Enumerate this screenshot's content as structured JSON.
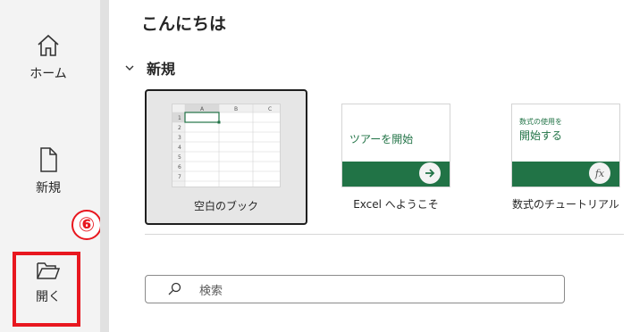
{
  "sidebar": {
    "home_label": "ホーム",
    "new_label": "新規",
    "open_label": "開く",
    "step_badge": "⑥"
  },
  "main": {
    "greeting": "こんにちは",
    "new_section_title": "新規",
    "templates": [
      {
        "label": "空白のブック",
        "selected": true
      },
      {
        "label": "Excel へようこそ",
        "thumb_text": "ツアーを開始"
      },
      {
        "label": "数式のチュートリアル",
        "thumb_text_small": "数式の使用を",
        "thumb_text_large": "開始する"
      }
    ],
    "blank_grid": {
      "columns": [
        "A",
        "B",
        "C"
      ],
      "rows": [
        "1",
        "2",
        "3",
        "4",
        "5",
        "6",
        "7"
      ]
    },
    "search_placeholder": "検索"
  },
  "colors": {
    "excel_green": "#217346",
    "annotation_red": "#e8171f"
  },
  "icons": {
    "home": "home-icon",
    "new": "new-document-icon",
    "open": "folder-open-icon",
    "chevron": "chevron-down-icon",
    "search": "search-icon",
    "arrow": "arrow-right-icon",
    "fx": "fx-icon"
  }
}
